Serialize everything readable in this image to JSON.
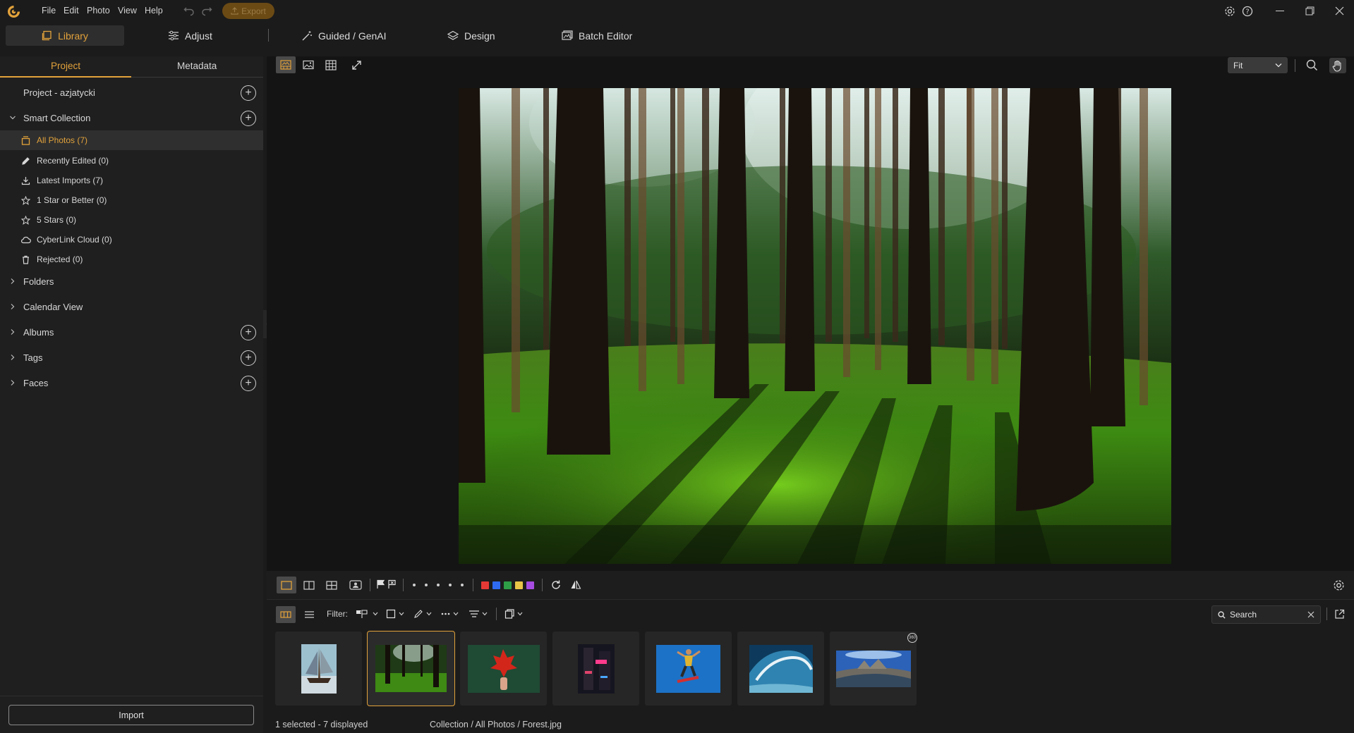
{
  "menu": [
    "File",
    "Edit",
    "Photo",
    "View",
    "Help"
  ],
  "export_label": "Export",
  "tabs": [
    {
      "label": "Library",
      "icon": "library-icon"
    },
    {
      "label": "Adjust",
      "icon": "sliders-icon"
    },
    {
      "label": "Guided / GenAI",
      "icon": "magic-wand-icon"
    },
    {
      "label": "Design",
      "icon": "layers-icon"
    },
    {
      "label": "Batch Editor",
      "icon": "batch-icon"
    }
  ],
  "panel_tabs": [
    "Project",
    "Metadata"
  ],
  "project_title": "Project - azjatycki",
  "smart_collection": {
    "label": "Smart Collection",
    "items": [
      {
        "label": "All Photos (7)",
        "icon": "photos-icon"
      },
      {
        "label": "Recently Edited (0)",
        "icon": "pencil-icon"
      },
      {
        "label": "Latest Imports (7)",
        "icon": "download-icon"
      },
      {
        "label": "1 Star or Better (0)",
        "icon": "star-icon"
      },
      {
        "label": "5 Stars (0)",
        "icon": "star-icon"
      },
      {
        "label": "CyberLink Cloud (0)",
        "icon": "cloud-icon"
      },
      {
        "label": "Rejected (0)",
        "icon": "trash-icon"
      }
    ]
  },
  "tree": [
    "Folders",
    "Calendar View",
    "Albums",
    "Tags",
    "Faces"
  ],
  "import_label": "Import",
  "zoom_value": "Fit",
  "filter_label": "Filter:",
  "search_placeholder": "Search",
  "status_selected": "1 selected - 7 displayed",
  "status_path": "Collection / All Photos / Forest.jpg",
  "colors": {
    "accent": "#e2a23b",
    "labels": [
      "#e53935",
      "#2e6bf0",
      "#2e9e47",
      "#e8c547",
      "#a64ce0"
    ]
  },
  "thumbnails": [
    "sailboat",
    "forest",
    "red-leaf",
    "neon-street",
    "skateboarder",
    "wave",
    "panorama"
  ]
}
